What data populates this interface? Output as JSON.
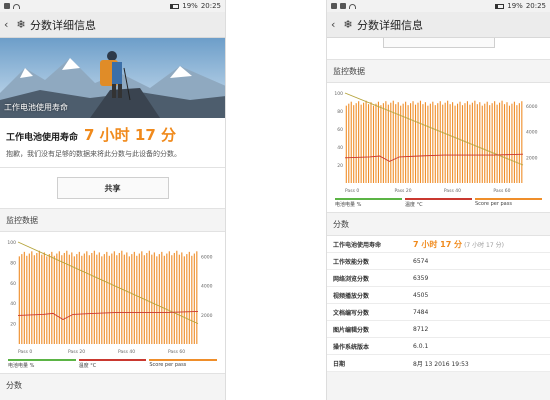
{
  "status": {
    "battery": "19%",
    "time": "20:25"
  },
  "header": {
    "title": "分数详细信息"
  },
  "hero": {
    "label": "工作电池使用寿命"
  },
  "result": {
    "life_label": "工作电池使用寿命",
    "life_value": "7 小时 17 分",
    "note": "抱歉，我们没有足够的数据来将此分数与此设备的分数。"
  },
  "share_label": "共享",
  "monitoring": {
    "title": "监控数据"
  },
  "legend": [
    {
      "label": "电池电量 %",
      "color": "#5bb445"
    },
    {
      "label": "温度 °C",
      "color": "#c9382f"
    },
    {
      "label": "Score per pass",
      "color": "#ef8e2a"
    }
  ],
  "scores": {
    "title": "分数",
    "rows": [
      {
        "key": "工作电池使用寿命",
        "value": "7 小时 17 分",
        "sub": "(7 小时 17 分)"
      },
      {
        "key": "工作效能分数",
        "value": "6574"
      },
      {
        "key": "网络浏览分数",
        "value": "6359"
      },
      {
        "key": "视频播放分数",
        "value": "4505"
      },
      {
        "key": "文档编写分数",
        "value": "7484"
      },
      {
        "key": "图片编辑分数",
        "value": "8712"
      },
      {
        "key": "操作系统版本",
        "value": "6.0.1"
      },
      {
        "key": "日期",
        "value": "8月 13 2016 19:53"
      }
    ]
  },
  "chart_data": {
    "type": "line",
    "x_ticks": [
      "Pass 0",
      "Pass 20",
      "Pass 40",
      "Pass 60"
    ],
    "x_range": [
      0,
      72
    ],
    "left_axis": {
      "ticks": [
        20,
        40,
        60,
        80,
        100
      ],
      "range": [
        0,
        100
      ]
    },
    "right_axis": {
      "ticks": [
        2000,
        4000,
        6000
      ],
      "range": [
        0,
        7000
      ]
    },
    "series": [
      {
        "name": "电池电量 %",
        "color": "#5bb445",
        "x": [
          0,
          72
        ],
        "values": [
          100,
          20
        ]
      },
      {
        "name": "温度 °C",
        "color": "#c9382f",
        "x": [
          0,
          10,
          14,
          18,
          22,
          30,
          40,
          50,
          60,
          72
        ],
        "values": [
          28,
          29,
          30,
          24,
          29,
          30,
          31,
          31,
          31,
          32
        ]
      },
      {
        "name": "Score per pass",
        "color": "#ef8e2a",
        "bars": 72,
        "values_approx": 6400
      }
    ]
  }
}
